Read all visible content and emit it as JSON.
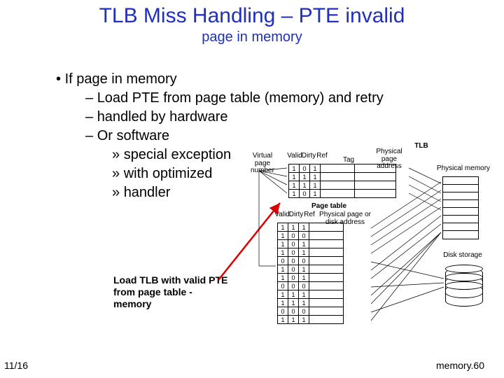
{
  "title": "TLB Miss Handling – PTE invalid",
  "subtitle": "page in memory",
  "bullets": {
    "l1": "If page  in memory",
    "l2a": "Load PTE from page table (memory) and retry",
    "l2b": "handled by hardware",
    "l2c": "Or  software",
    "l3a": "special exception",
    "l3b": "with optimized",
    "l3c": "handler"
  },
  "annotation": {
    "lead": "Load TLB",
    "rest": " with valid PTE from page table - memory"
  },
  "diagram": {
    "labels": {
      "vpn": "Virtual page number",
      "valid": "Valid",
      "dirty": "Dirty",
      "ref": "Ref",
      "tag": "Tag",
      "ppa": "Physical page address",
      "tlb": "TLB",
      "pt": "Page table",
      "pt_sub": "Physical page or disk address",
      "pm": "Physical memory",
      "disk": "Disk storage"
    },
    "tlb_rows": [
      [
        1,
        0,
        1
      ],
      [
        1,
        1,
        1
      ],
      [
        1,
        1,
        1
      ],
      [
        1,
        0,
        1
      ]
    ],
    "pt_rows": [
      [
        1,
        1,
        1
      ],
      [
        1,
        0,
        0
      ],
      [
        1,
        0,
        1
      ],
      [
        1,
        0,
        1
      ],
      [
        0,
        0,
        0
      ],
      [
        1,
        0,
        1
      ],
      [
        1,
        0,
        1
      ],
      [
        0,
        0,
        0
      ],
      [
        1,
        1,
        1
      ],
      [
        1,
        1,
        1
      ],
      [
        0,
        0,
        0
      ],
      [
        1,
        1,
        1
      ]
    ]
  },
  "footer": {
    "date": "11/16",
    "pageno": "memory.60"
  }
}
